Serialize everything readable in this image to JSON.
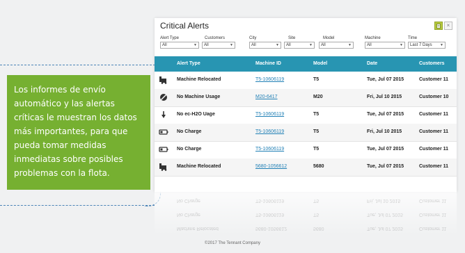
{
  "panel": {
    "title": "Critical Alerts",
    "filters": [
      {
        "label": "Alert Type",
        "value": "All"
      },
      {
        "label": "Customers",
        "value": "All"
      },
      {
        "label": "City",
        "value": "All"
      },
      {
        "label": "Site",
        "value": "All"
      },
      {
        "label": "Model",
        "value": "All"
      },
      {
        "label": "Machine",
        "value": "All"
      },
      {
        "label": "Time",
        "value": "Last 7 Days"
      }
    ],
    "columns": [
      "Alert Type",
      "Machine ID",
      "Model",
      "Date",
      "Customers"
    ],
    "rows": [
      {
        "icon": "machine-relocated-icon",
        "alert_type": "Machine Relocated",
        "machine_id": "T5-10606119",
        "model": "T5",
        "date": "Tue, Jul 07 2015",
        "customer": "Customer 11"
      },
      {
        "icon": "no-usage-icon",
        "alert_type": "No Machine Usage",
        "machine_id": "M20-6417",
        "model": "M20",
        "date": "Fri, Jul 10 2015",
        "customer": "Customer 10"
      },
      {
        "icon": "water-drop-icon",
        "alert_type": "No ec-H2O Uage",
        "machine_id": "T5-10606119",
        "model": "T5",
        "date": "Tue, Jul 07 2015",
        "customer": "Customer 11"
      },
      {
        "icon": "battery-icon",
        "alert_type": "No Charge",
        "machine_id": "T5-10606119",
        "model": "T5",
        "date": "Fri, Jul 10 2015",
        "customer": "Customer 11"
      },
      {
        "icon": "battery-icon",
        "alert_type": "No Charge",
        "machine_id": "T5-10606119",
        "model": "T5",
        "date": "Tue, Jul 07 2015",
        "customer": "Customer 11"
      },
      {
        "icon": "machine-relocated-icon",
        "alert_type": "Machine Relocated",
        "machine_id": "5680-1056612",
        "model": "5680",
        "date": "Tue, Jul 07 2015",
        "customer": "Customer 11"
      }
    ]
  },
  "callout": {
    "text": "Los informes de envío automático y las alertas críticas le muestran los datos más importantes, para que pueda tomar medidas inmediatas sobre posibles problemas con la flota."
  },
  "footer": {
    "copyright": "©2017 The Tennant Company"
  },
  "colors": {
    "header": "#2895b2",
    "callout": "#76b031",
    "link": "#1f7fb5"
  }
}
